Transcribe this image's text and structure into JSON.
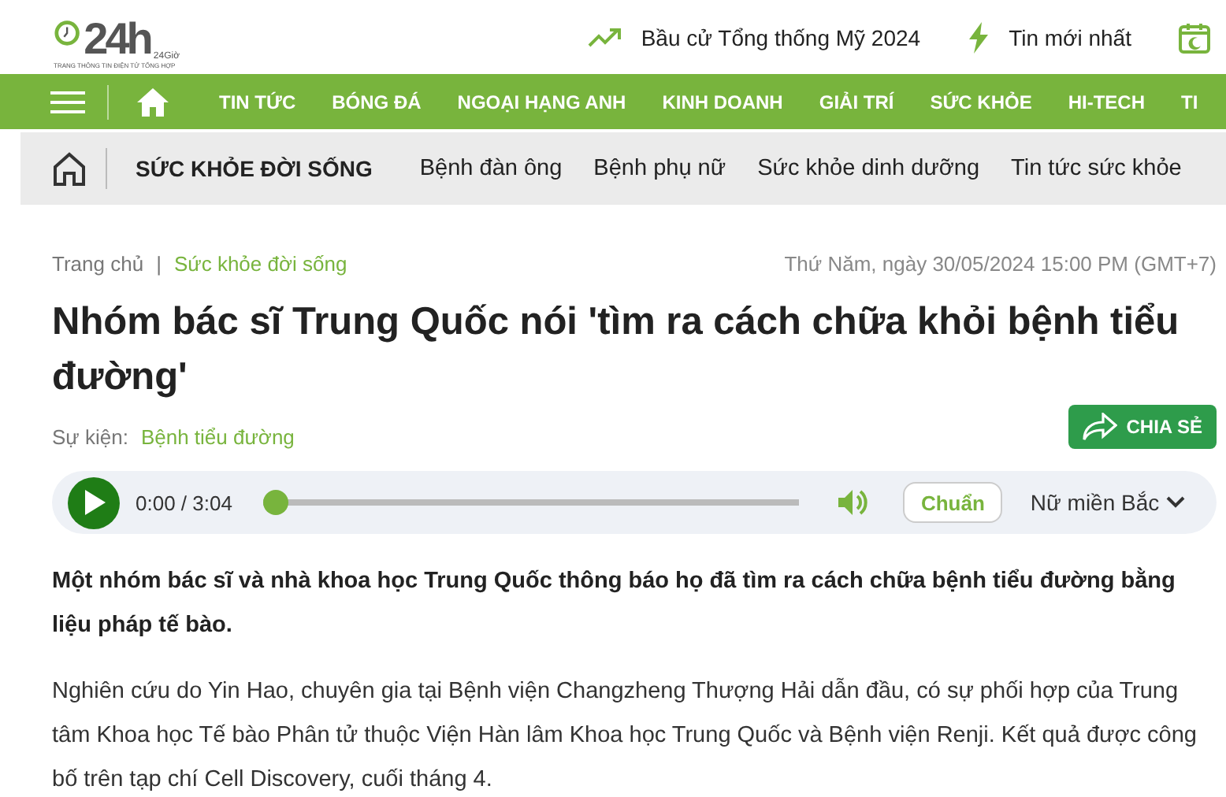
{
  "logo": {
    "mark": "24h",
    "sub": "24Giờ",
    "tagline": "TRANG THÔNG TIN ĐIỆN TỬ TỔNG HỢP"
  },
  "top_links": [
    {
      "kind": "trend",
      "label": "Bầu cử Tổng thống Mỹ 2024"
    },
    {
      "kind": "bolt",
      "label": "Tin mới nhất"
    },
    {
      "kind": "calendar"
    }
  ],
  "main_nav": [
    "TIN TỨC",
    "BÓNG ĐÁ",
    "NGOẠI HẠNG ANH",
    "KINH DOANH",
    "GIẢI TRÍ",
    "SỨC KHỎE",
    "HI-TECH",
    "TI"
  ],
  "sub_nav": {
    "title": "SỨC KHỎE ĐỜI SỐNG",
    "items": [
      "Bệnh đàn ông",
      "Bệnh phụ nữ",
      "Sức khỏe dinh dưỡng",
      "Tin tức sức khỏe"
    ]
  },
  "breadcrumb": [
    "Trang chủ",
    "Sức khỏe đời sống"
  ],
  "breadcrumb_separator": "|",
  "date": "Thứ Năm, ngày 30/05/2024 15:00 PM (GMT+7)",
  "headline": "Nhóm bác sĩ Trung Quốc nói 'tìm ra cách chữa khỏi bệnh tiểu đường'",
  "event": {
    "label": "Sự kiện:",
    "link": "Bệnh tiểu đường"
  },
  "share_button": "CHIA SẺ",
  "audio": {
    "time": "0:00 / 3:04",
    "level": 0,
    "speed": "Chuẩn",
    "voice": "Nữ miền Bắc"
  },
  "lead": "Một nhóm bác sĩ và nhà khoa học Trung Quốc thông báo họ đã tìm ra cách chữa bệnh tiểu đường bằng liệu pháp tế bào.",
  "body": [
    "Nghiên cứu do Yin Hao, chuyên gia tại Bệnh viện Changzheng Thượng Hải dẫn đầu, có sự phối hợp của Trung tâm Khoa học Tế bào Phân tử thuộc Viện Hàn lâm Khoa học Trung Quốc và Bệnh viện Renji. Kết quả được công bố trên tạp chí Cell Discovery, cuối tháng 4."
  ]
}
